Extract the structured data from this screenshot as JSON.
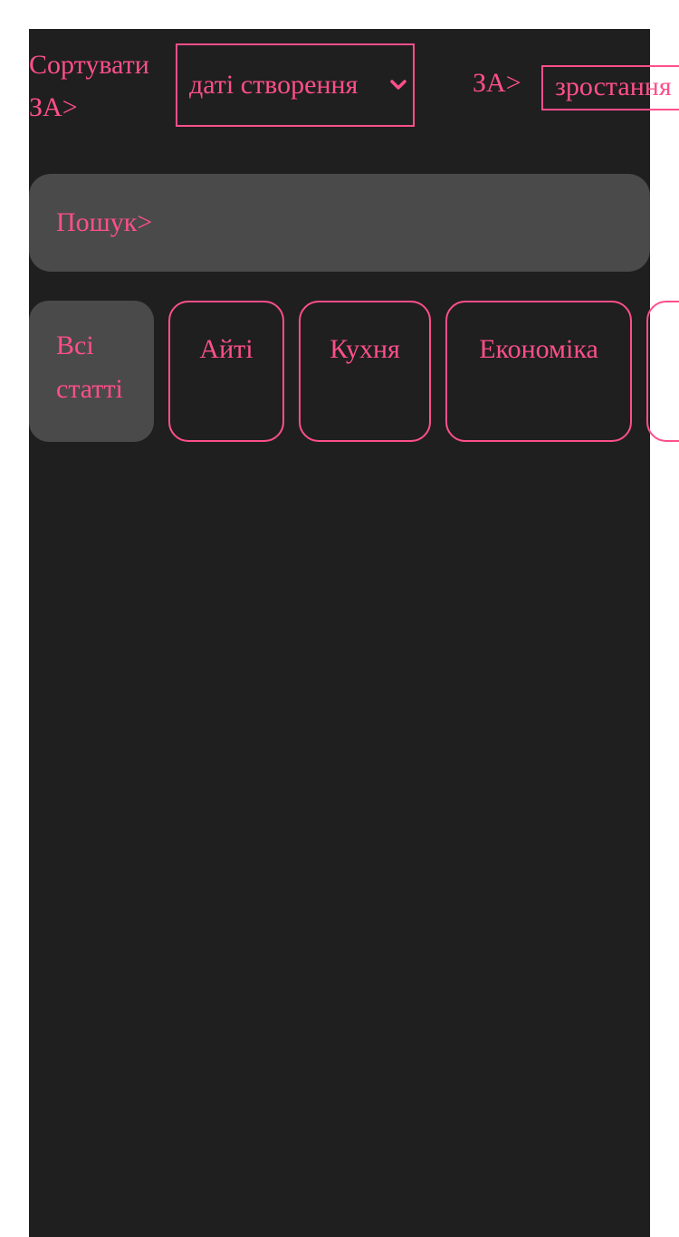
{
  "sort": {
    "label": "Сортувати ЗА>",
    "selected": "даті створення"
  },
  "order": {
    "label": "ЗА>",
    "selected": "зростання"
  },
  "search": {
    "placeholder": "Пошук>"
  },
  "categories": [
    {
      "label": "Всі статті",
      "active": true
    },
    {
      "label": "Айті",
      "active": false
    },
    {
      "label": "Кухня",
      "active": false
    },
    {
      "label": "Економіка",
      "active": false
    }
  ],
  "colors": {
    "accent": "#ff4f8b",
    "panel": "#1f1f1f",
    "surface": "#4a4a4a"
  }
}
